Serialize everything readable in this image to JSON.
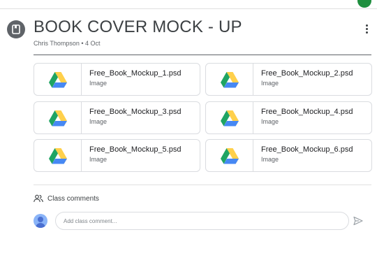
{
  "post": {
    "title": "BOOK COVER MOCK - UP",
    "meta": "Chris Thompson • 4 Oct"
  },
  "attachments": [
    {
      "name": "Free_Book_Mockup_1.psd",
      "type": "Image",
      "icon": "google-drive-icon"
    },
    {
      "name": "Free_Book_Mockup_2.psd",
      "type": "Image",
      "icon": "google-drive-icon"
    },
    {
      "name": "Free_Book_Mockup_3.psd",
      "type": "Image",
      "icon": "google-drive-icon"
    },
    {
      "name": "Free_Book_Mockup_4.psd",
      "type": "Image",
      "icon": "google-drive-icon"
    },
    {
      "name": "Free_Book_Mockup_5.psd",
      "type": "Image",
      "icon": "google-drive-icon"
    },
    {
      "name": "Free_Book_Mockup_6.psd",
      "type": "Image",
      "icon": "google-drive-icon"
    }
  ],
  "comments": {
    "label": "Class comments",
    "placeholder": "Add class comment..."
  },
  "colors": {
    "drive_green": "#1fa463",
    "drive_yellow": "#ffd04b",
    "drive_blue": "#4688f4",
    "post_icon": "#5f6368"
  }
}
